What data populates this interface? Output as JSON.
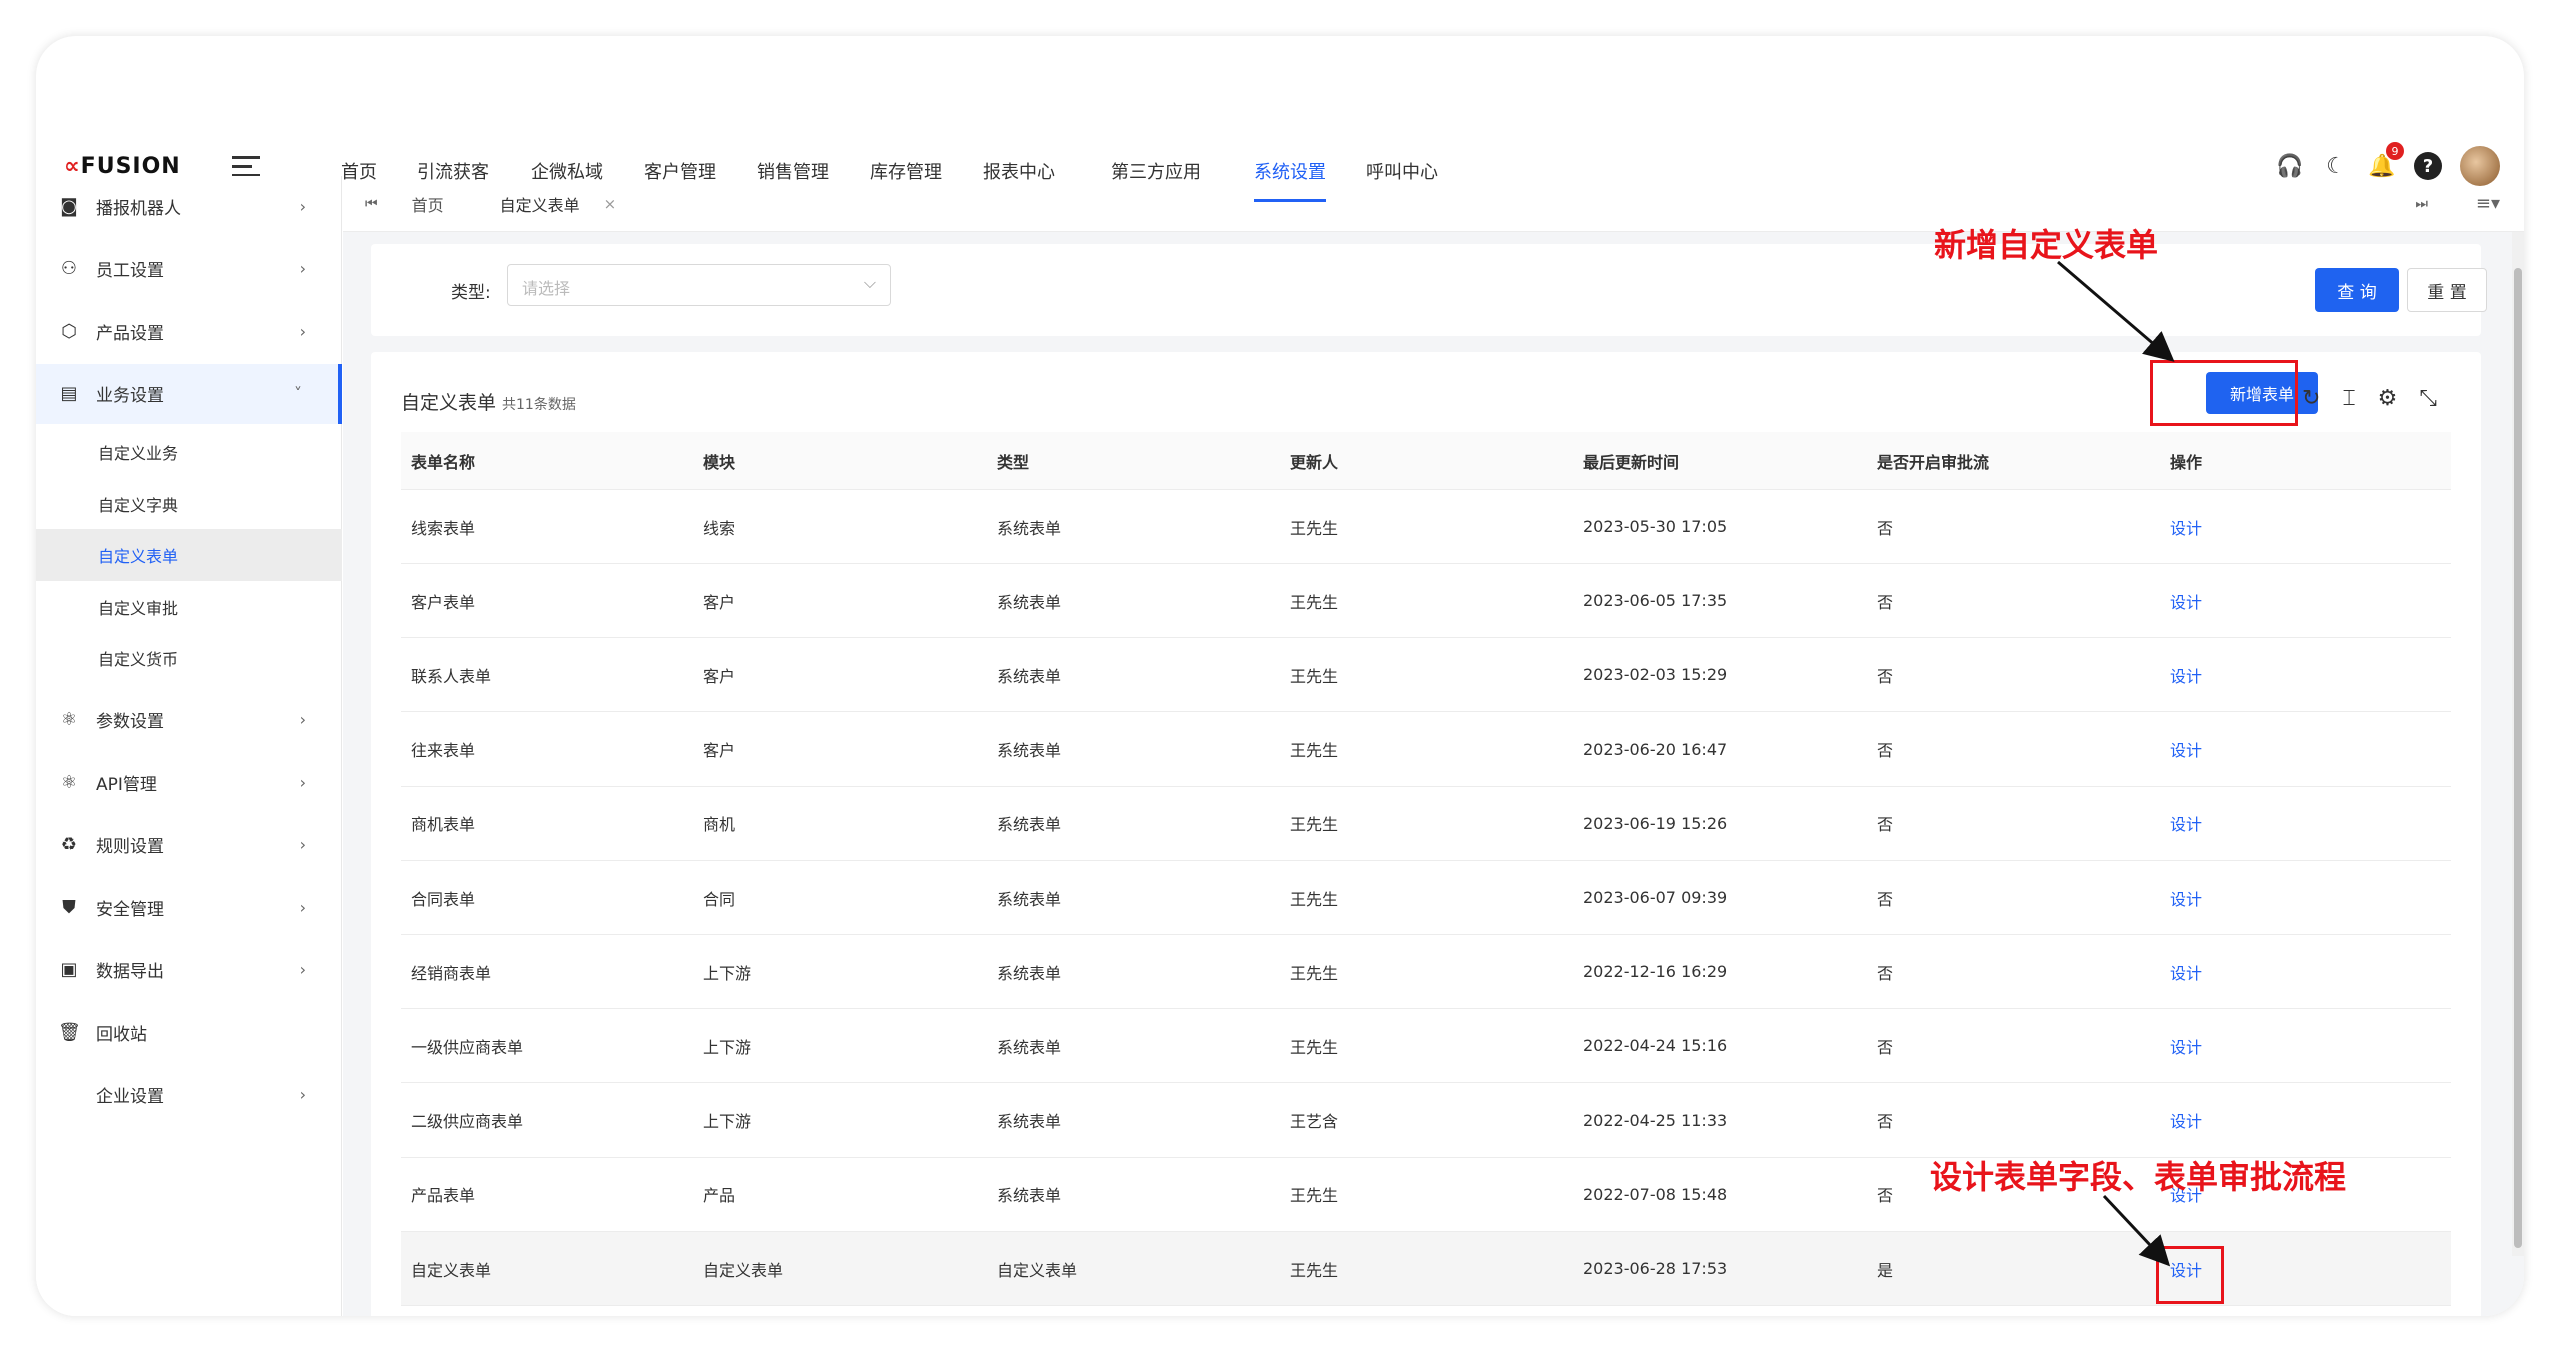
{
  "app": {
    "logo_prefix": "∝",
    "logo_text": "FUSION"
  },
  "nav": [
    "首页",
    "引流获客",
    "企微私域",
    "客户管理",
    "销售管理",
    "库存管理",
    "报表中心",
    "第三方应用",
    "系统设置",
    "呼叫中心"
  ],
  "nav_active": "系统设置",
  "top_icons": {
    "notification_count": "9"
  },
  "sidebar": {
    "items": [
      {
        "label": "播报机器人",
        "icon": "robot-icon"
      },
      {
        "label": "员工设置",
        "icon": "user-gear-icon"
      },
      {
        "label": "产品设置",
        "icon": "box-icon"
      },
      {
        "label": "业务设置",
        "icon": "server-icon"
      },
      {
        "label": "参数设置",
        "icon": "atom-icon"
      },
      {
        "label": "API管理",
        "icon": "atom-icon"
      },
      {
        "label": "规则设置",
        "icon": "recycle-icon"
      },
      {
        "label": "安全管理",
        "icon": "shield-icon"
      },
      {
        "label": "数据导出",
        "icon": "file-export-icon"
      },
      {
        "label": "回收站",
        "icon": "trash-icon"
      },
      {
        "label": "企业设置",
        "icon": ""
      }
    ],
    "sub_items": [
      "自定义业务",
      "自定义字典",
      "自定义表单",
      "自定义审批",
      "自定义货币"
    ],
    "active_sub": "自定义表单"
  },
  "tabs": {
    "home": "首页",
    "current": "自定义表单",
    "close": "×"
  },
  "filter": {
    "label": "类型:",
    "placeholder": "请选择",
    "query_button": "查 询",
    "reset_button": "重 置"
  },
  "table": {
    "title": "自定义表单",
    "count_text": "共11条数据",
    "add_button": "新增表单",
    "columns": [
      "表单名称",
      "模块",
      "类型",
      "更新人",
      "最后更新时间",
      "是否开启审批流",
      "操作"
    ],
    "rows": [
      [
        "线索表单",
        "线索",
        "系统表单",
        "王先生",
        "2023-05-30 17:05",
        "否",
        "设计"
      ],
      [
        "客户表单",
        "客户",
        "系统表单",
        "王先生",
        "2023-06-05 17:35",
        "否",
        "设计"
      ],
      [
        "联系人表单",
        "客户",
        "系统表单",
        "王先生",
        "2023-02-03 15:29",
        "否",
        "设计"
      ],
      [
        "往来表单",
        "客户",
        "系统表单",
        "王先生",
        "2023-06-20 16:47",
        "否",
        "设计"
      ],
      [
        "商机表单",
        "商机",
        "系统表单",
        "王先生",
        "2023-06-19 15:26",
        "否",
        "设计"
      ],
      [
        "合同表单",
        "合同",
        "系统表单",
        "王先生",
        "2023-06-07 09:39",
        "否",
        "设计"
      ],
      [
        "经销商表单",
        "上下游",
        "系统表单",
        "王先生",
        "2022-12-16 16:29",
        "否",
        "设计"
      ],
      [
        "一级供应商表单",
        "上下游",
        "系统表单",
        "王先生",
        "2022-04-24 15:16",
        "否",
        "设计"
      ],
      [
        "二级供应商表单",
        "上下游",
        "系统表单",
        "王艺含",
        "2022-04-25 11:33",
        "否",
        "设计"
      ],
      [
        "产品表单",
        "产品",
        "系统表单",
        "王先生",
        "2022-07-08 15:48",
        "否",
        "设计"
      ],
      [
        "自定义表单",
        "自定义表单",
        "自定义表单",
        "王先生",
        "2023-06-28 17:53",
        "是",
        "设计"
      ]
    ]
  },
  "annotations": {
    "add_form": "新增自定义表单",
    "design_form": "设计表单字段、表单审批流程",
    "color": "#e8141b"
  },
  "colors": {
    "primary": "#1f63f0",
    "link": "#2161f5"
  }
}
